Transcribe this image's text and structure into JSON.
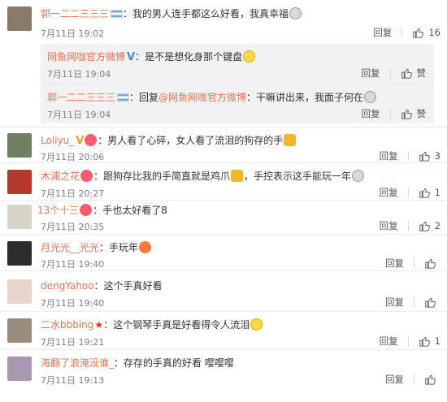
{
  "comments": [
    {
      "user": "郭一二二三三三",
      "badge": "flag",
      "text": "：我的男人连手都这么好看，我真幸福",
      "emoji": "sad",
      "time": "7月11日 19:02",
      "reply_label": "回复",
      "likes": "16",
      "avatar_color": "#8a7a6a",
      "replies": [
        {
          "user": "网鱼网咖官方微博",
          "badge": "V",
          "text": "：是不是想化身那个键盘",
          "emoji_after": "happy",
          "time": "7月11日 19:04",
          "reply_label": "回复",
          "like_label": "赞"
        },
        {
          "user": "郭一二二三三三",
          "badge": "flag",
          "prefix": "：回复",
          "mention": "@网鱼网咖官方微博",
          "text": "：干嘛讲出来，我面子何在",
          "emoji_after": "sad",
          "time": "7月11日 19:04",
          "reply_label": "回复",
          "like_label": "赞"
        }
      ]
    },
    {
      "user": "Loliyu_",
      "badge": "V-heart",
      "text": "：男人看了心碎，女人看了流泪的狗存的手",
      "time": "7月11日 20:06",
      "reply_label": "回复",
      "likes": "3",
      "avatar_color": "#6f7f63"
    },
    {
      "user": "木浦之花",
      "badge": "heart",
      "text": "：跟狗存比我的手简直就是鸡爪",
      "text2": "，手控表示这手能玩一年",
      "time": "7月11日 20:27",
      "reply_label": "回复",
      "likes": "1",
      "avatar_color": "#b43a2e"
    },
    {
      "user": "13个十三",
      "badge": "heart",
      "text": "：手也太好看了8",
      "time": "7月11日 20:35",
      "reply_label": "回复",
      "likes": "2",
      "avatar_color": "#d8d4c8"
    },
    {
      "user": "月光光__光光",
      "badge": "",
      "text": "：手玩年",
      "emoji_after": "heart",
      "time": "7月11日 19:40",
      "reply_label": "回复",
      "likes": "",
      "avatar_color": "#2d2d2d"
    },
    {
      "user": "dengYahoo",
      "badge": "",
      "text": "：这个手真好看",
      "time": "7月11日 19:40",
      "reply_label": "回复",
      "likes": "",
      "avatar_color": "#e7d6c9"
    },
    {
      "user": "二水bbbing",
      "badge": "star",
      "text": "：这个钢琴手真是好看得令人流泪",
      "emoji_after": "happy",
      "time": "7月11日 19:21",
      "reply_label": "回复",
      "likes": "1",
      "avatar_color": "#9a8c7e"
    },
    {
      "user": "海翻了浪淹没谁_",
      "badge": "",
      "text": "：存存的手真的好看 嘤嘤嘤",
      "time": "7月11日 19:13",
      "reply_label": "回复",
      "likes": "",
      "avatar_color": "#a897b0"
    }
  ]
}
